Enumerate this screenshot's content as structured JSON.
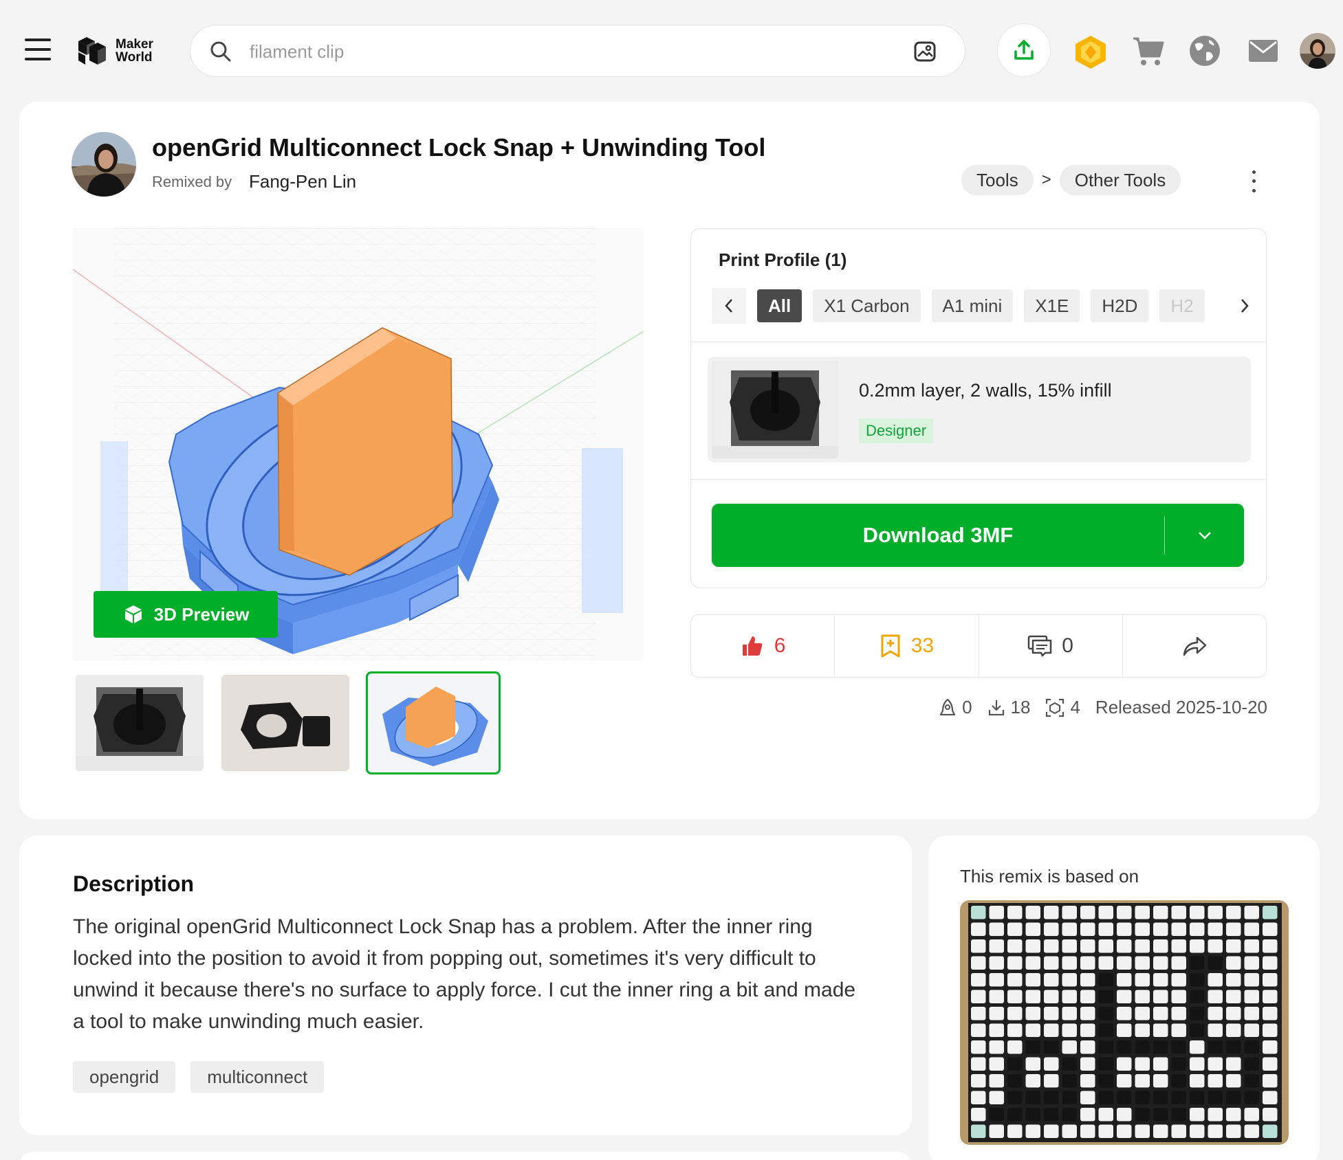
{
  "nav": {
    "logo_line1": "Maker",
    "logo_line2": "World",
    "search_placeholder": "filament clip"
  },
  "model": {
    "title": "openGrid Multiconnect Lock Snap + Unwinding Tool",
    "remixed_by_label": "Remixed by",
    "author": "Fang-Pen Lin",
    "breadcrumb": [
      "Tools",
      "Other Tools"
    ],
    "breadcrumb_sep": ">"
  },
  "preview": {
    "button_label": "3D Preview"
  },
  "print_profile": {
    "title": "Print Profile (1)",
    "tabs": [
      "All",
      "X1 Carbon",
      "A1 mini",
      "X1E",
      "H2D",
      "H2"
    ],
    "active_tab": "All",
    "item_title": "0.2mm layer, 2 walls, 15% infill",
    "item_badge": "Designer",
    "download_label": "Download 3MF"
  },
  "stats": {
    "likes": "6",
    "collects": "33",
    "comments": "0"
  },
  "meta": {
    "boosts": "0",
    "downloads": "18",
    "prints": "4",
    "released": "Released 2025-10-20"
  },
  "description": {
    "heading": "Description",
    "body": "The original openGrid Multiconnect Lock Snap has a problem. After the inner ring locked into the position to avoid it from popping out, sometimes it's very difficult to unwind it because there's no surface to apply force. I cut the inner ring a bit and made a tool to make unwinding much easier.",
    "tags": [
      "opengrid",
      "multiconnect"
    ]
  },
  "remix": {
    "heading": "This remix is based on"
  },
  "colors": {
    "accent_green": "#00ae2a",
    "like_red": "#e03b3b",
    "collect_amber": "#f0a400",
    "model_blue": "#6f9ff0",
    "model_orange": "#f9a862"
  }
}
